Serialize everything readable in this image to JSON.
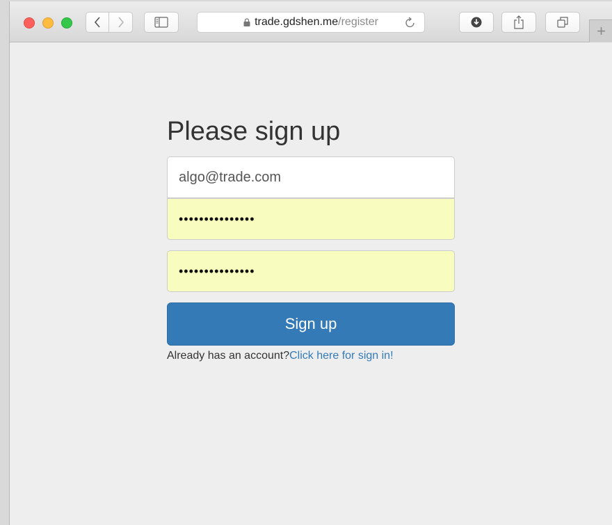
{
  "browser": {
    "url_host": "trade.gdshen.me",
    "url_path": "/register",
    "newtab_label": "+"
  },
  "form": {
    "heading": "Please sign up",
    "email_value": "algo@trade.com",
    "password_value": "•••••••••••••••",
    "confirm_value": "•••••••••••••••",
    "submit_label": "Sign up",
    "helper_text": "Already has an account?",
    "signin_link": "Click here for sign in!"
  },
  "colors": {
    "primary": "#337ab7",
    "autofill": "#f8fcbf"
  }
}
